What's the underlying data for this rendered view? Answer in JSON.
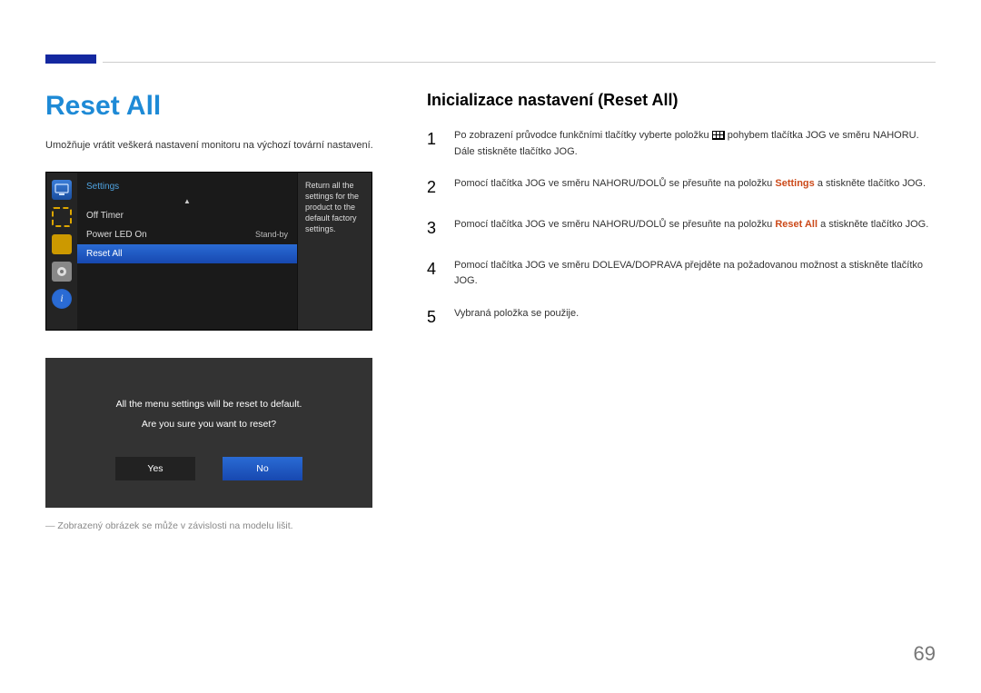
{
  "page_number": "69",
  "left": {
    "title": "Reset All",
    "intro": "Umožňuje vrátit veškerá nastavení monitoru na výchozí tovární nastavení.",
    "caption": "Zobrazený obrázek se může v závislosti na modelu lišit."
  },
  "osd1": {
    "header": "Settings",
    "items": [
      {
        "label": "Off Timer",
        "value": ""
      },
      {
        "label": "Power LED On",
        "value": "Stand-by"
      },
      {
        "label": "Reset All",
        "value": "",
        "selected": true
      }
    ],
    "help": "Return all the settings for the product to the default factory settings."
  },
  "osd2": {
    "msg1": "All the menu settings will be reset to default.",
    "msg2": "Are you sure you want to reset?",
    "yes": "Yes",
    "no": "No"
  },
  "right": {
    "heading": "Inicializace nastavení (Reset All)",
    "steps": {
      "s1a": "Po zobrazení průvodce funkčními tlačítky vyberte položku ",
      "s1b": " pohybem tlačítka JOG ve směru NAHORU. Dále stiskněte tlačítko JOG.",
      "s2a": "Pomocí tlačítka JOG ve směru NAHORU/DOLŮ se přesuňte na položku ",
      "s2_settings": "Settings",
      "s2b": " a stiskněte tlačítko JOG.",
      "s3a": "Pomocí tlačítka JOG ve směru NAHORU/DOLŮ se přesuňte na položku ",
      "s3_reset": "Reset All",
      "s3b": " a stiskněte tlačítko JOG.",
      "s4": "Pomocí tlačítka JOG ve směru DOLEVA/DOPRAVA přejděte na požadovanou možnost a stiskněte tlačítko JOG.",
      "s5": "Vybraná položka se použije."
    },
    "nums": {
      "n1": "1",
      "n2": "2",
      "n3": "3",
      "n4": "4",
      "n5": "5"
    }
  }
}
